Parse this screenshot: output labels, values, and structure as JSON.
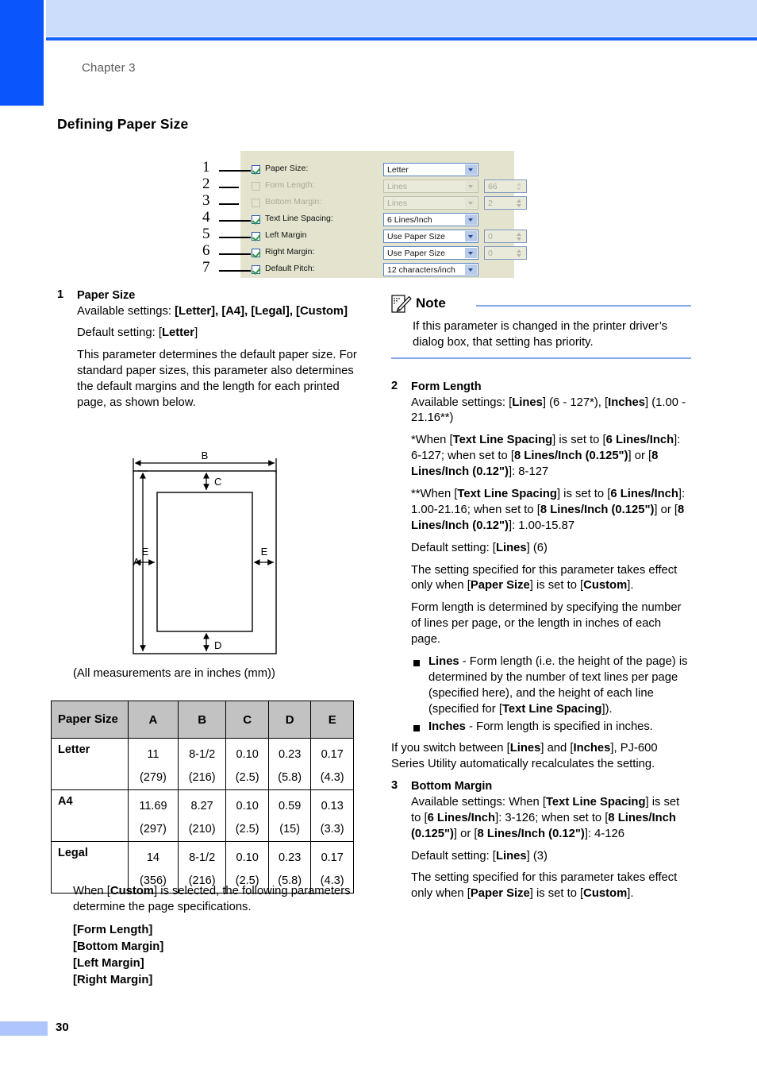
{
  "page": {
    "chapter": "Chapter 3",
    "section_title": "Defining Paper Size",
    "page_number": "30"
  },
  "dialog": {
    "rows": [
      {
        "num": "1",
        "checkbox": "checked",
        "label": "Paper Size:",
        "combo_value": "Letter",
        "combo_width": 120,
        "spin_value": null,
        "enabled": true
      },
      {
        "num": "2",
        "checkbox": "unchecked",
        "label": "Form Length:",
        "combo_value": "Lines",
        "combo_width": 120,
        "spin_value": "66",
        "enabled": false
      },
      {
        "num": "3",
        "checkbox": "unchecked",
        "label": "Bottom Margin:",
        "combo_value": "Lines",
        "combo_width": 120,
        "spin_value": "2",
        "enabled": false
      },
      {
        "num": "4",
        "checkbox": "checked",
        "label": "Text Line Spacing:",
        "combo_value": "6 Lines/Inch",
        "combo_width": 120,
        "spin_value": null,
        "enabled": true
      },
      {
        "num": "5",
        "checkbox": "checked",
        "label": "Left Margin",
        "combo_value": "Use Paper Size",
        "combo_width": 120,
        "spin_value": "0",
        "enabled": true
      },
      {
        "num": "6",
        "checkbox": "checked",
        "label": "Right Margin:",
        "combo_value": "Use Paper Size",
        "combo_width": 120,
        "spin_value": "0",
        "enabled": true
      },
      {
        "num": "7",
        "checkbox": "checked",
        "label": "Default Pitch:",
        "combo_value": "12 characters/inch",
        "combo_width": 120,
        "spin_value": null,
        "enabled": true
      }
    ]
  },
  "item1": {
    "number": "1",
    "heading": "Paper Size",
    "available_label": "Available settings: ",
    "available_values": "[Letter], [A4], [Legal], [Custom]",
    "default_label": "Default setting: ",
    "default_value": "[Letter]",
    "description": "This parameter determines the default paper size. For standard paper sizes, this parameter also determines the default margins and the length for each printed page, as shown below."
  },
  "diagram": {
    "labels": {
      "a": "A",
      "b": "B",
      "c": "C",
      "d": "D",
      "e_left": "E",
      "e_right": "E"
    },
    "caption": "(All measurements are in inches (mm))"
  },
  "table": {
    "headers": [
      "Paper Size",
      "A",
      "B",
      "C",
      "D",
      "E"
    ],
    "rows": [
      {
        "name": "Letter",
        "values": [
          [
            "11",
            "(279)"
          ],
          [
            "8-1/2",
            "(216)"
          ],
          [
            "0.10",
            "(2.5)"
          ],
          [
            "0.23",
            "(5.8)"
          ],
          [
            "0.17",
            "(4.3)"
          ]
        ]
      },
      {
        "name": "A4",
        "values": [
          [
            "11.69",
            "(297)"
          ],
          [
            "8.27",
            "(210)"
          ],
          [
            "0.10",
            "(2.5)"
          ],
          [
            "0.59",
            "(15)"
          ],
          [
            "0.13",
            "(3.3)"
          ]
        ]
      },
      {
        "name": "Legal",
        "values": [
          [
            "14",
            "(356)"
          ],
          [
            "8-1/2",
            "(216)"
          ],
          [
            "0.10",
            "(2.5)"
          ],
          [
            "0.23",
            "(5.8)"
          ],
          [
            "0.17",
            "(4.3)"
          ]
        ]
      }
    ]
  },
  "left_tail": {
    "intro": "When [Custom] is selected, the following parameters determine the page specifications.",
    "params": [
      "[Form Length]",
      "[Bottom Margin]",
      "[Left Margin]",
      "[Right Margin]"
    ]
  },
  "note": {
    "icon": "note-pencil-icon",
    "title": "Note",
    "body": "If this parameter is changed in the printer driver’s dialog box, that setting has priority."
  },
  "item2": {
    "number": "2",
    "heading": "Form Length",
    "available": "Available settings: [Lines] (6 - 127*), [Inches] (1.00 - 21.16**)",
    "footnote1": "*When [Text Line Spacing] is set to [6 Lines/Inch]: 6-127; when set to [8 Lines/Inch (0.125\")] or [8 Lines/Inch (0.12\")]: 8-127",
    "footnote2": "**When [Text Line Spacing] is set to [6 Lines/Inch]: 1.00-21.16; when set to [8 Lines/Inch (0.125\")] or [8 Lines/Inch (0.12\")]: 1.00-15.87",
    "default": "Default setting: [Lines] (6)",
    "effect": "The setting specified for this parameter takes effect only when [Paper Size] is set to [Custom].",
    "explain": "Form length is determined by specifying the number of lines per page, or the length in inches of each page.",
    "bullets": [
      "Lines - Form length (i.e. the height of the page) is determined by the number of text lines per page (specified here), and the height of each line (specified for [Text Line Spacing]).",
      "Inches - Form length is specified in inches."
    ],
    "switch_note": "If you switch between [Lines] and [Inches], PJ-600 Series Utility automatically recalculates the setting."
  },
  "item3": {
    "number": "3",
    "heading": "Bottom Margin",
    "available": "Available settings: When [Text Line Spacing] is set to [6 Lines/Inch]: 3-126; when set to [8 Lines/Inch (0.125\")] or [8 Lines/Inch (0.12\")]: 4-126",
    "default": "Default setting: [Lines] (3)",
    "effect": "The setting specified for this parameter takes effect only when [Paper Size] is set to [Custom]."
  },
  "colors": {
    "brand_blue": "#0a55fc",
    "header_band": "#ccdcfb",
    "note_rule": "#8aa9e8",
    "table_header": "#c2c2c2",
    "dialog_bg": "#e3e3ce"
  }
}
